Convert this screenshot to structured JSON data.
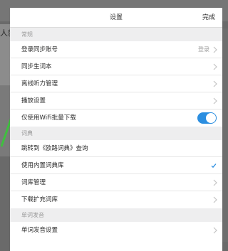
{
  "background": {
    "partial_text": "人就"
  },
  "settings": {
    "title": "设置",
    "done_label": "完成",
    "sections": [
      {
        "header": "常规",
        "rows": [
          {
            "label": "登录同步账号",
            "value": "登录",
            "accessory": "chevron"
          },
          {
            "label": "同步生词本",
            "accessory": "chevron"
          },
          {
            "label": "离线听力管理",
            "accessory": "chevron"
          },
          {
            "label": "播放设置",
            "accessory": "chevron"
          },
          {
            "label": "仅使用WiFi批量下载",
            "accessory": "toggle",
            "toggle_on": true
          }
        ]
      },
      {
        "header": "词典",
        "rows": [
          {
            "label": "跳转到《欧路词典》查询",
            "accessory": "none"
          },
          {
            "label": "使用内置词典库",
            "accessory": "check"
          },
          {
            "label": "词库管理",
            "accessory": "chevron"
          },
          {
            "label": "下载扩充词库",
            "accessory": "chevron"
          }
        ]
      },
      {
        "header": "单词发音",
        "rows": [
          {
            "label": "单词发音设置",
            "accessory": "chevron"
          }
        ]
      }
    ]
  },
  "colors": {
    "accent": "#2b8ee0",
    "section_bg": "#eeeeef",
    "overlay": "#6a6a6a"
  }
}
